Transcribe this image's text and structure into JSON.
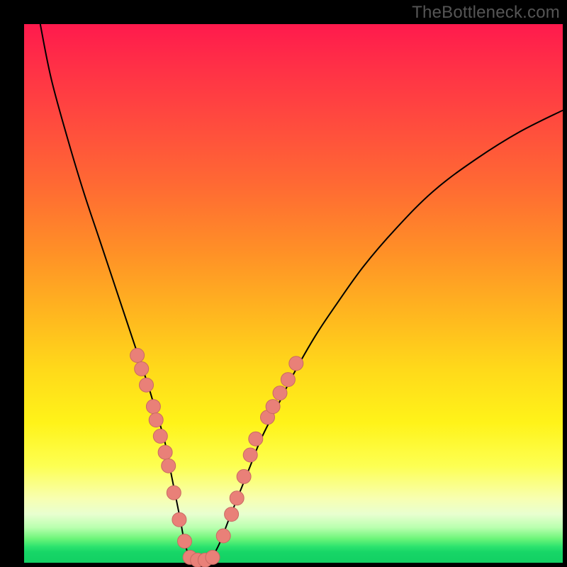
{
  "watermark": "TheBottleneck.com",
  "chart_data": {
    "type": "line",
    "title": "",
    "xlabel": "",
    "ylabel": "",
    "xlim": [
      0,
      100
    ],
    "ylim": [
      0,
      100
    ],
    "grid": false,
    "series": [
      {
        "name": "bottleneck-curve",
        "x": [
          3,
          5,
          8,
          11,
          14,
          17,
          19,
          21,
          23,
          24.5,
          26,
          27,
          28,
          29,
          30,
          31.5,
          34,
          36,
          38,
          40,
          42,
          44,
          47,
          50,
          54,
          58,
          63,
          69,
          76,
          84,
          92,
          100
        ],
        "y": [
          100,
          90,
          79,
          69,
          60,
          51,
          45,
          39,
          33,
          28,
          23,
          18,
          13,
          8,
          3,
          0,
          0,
          3,
          8,
          13,
          18,
          23,
          29,
          35,
          42,
          48,
          55,
          62,
          69,
          75,
          80,
          84
        ],
        "stroke": "#000000",
        "stroke_width": 2
      }
    ],
    "markers": [
      {
        "name": "left-cluster",
        "points": [
          {
            "x": 21.0,
            "y": 38.5
          },
          {
            "x": 21.8,
            "y": 36.0
          },
          {
            "x": 22.7,
            "y": 33.0
          },
          {
            "x": 24.0,
            "y": 29.0
          },
          {
            "x": 24.5,
            "y": 26.5
          },
          {
            "x": 25.3,
            "y": 23.5
          },
          {
            "x": 26.2,
            "y": 20.5
          },
          {
            "x": 26.8,
            "y": 18.0
          },
          {
            "x": 27.8,
            "y": 13.0
          },
          {
            "x": 28.8,
            "y": 8.0
          },
          {
            "x": 29.8,
            "y": 4.0
          }
        ]
      },
      {
        "name": "bottom-cluster",
        "points": [
          {
            "x": 30.8,
            "y": 1.0
          },
          {
            "x": 32.2,
            "y": 0.5
          },
          {
            "x": 33.6,
            "y": 0.5
          },
          {
            "x": 35.0,
            "y": 1.0
          }
        ]
      },
      {
        "name": "right-cluster",
        "points": [
          {
            "x": 37.0,
            "y": 5.0
          },
          {
            "x": 38.5,
            "y": 9.0
          },
          {
            "x": 39.5,
            "y": 12.0
          },
          {
            "x": 40.8,
            "y": 16.0
          },
          {
            "x": 42.0,
            "y": 20.0
          },
          {
            "x": 43.0,
            "y": 23.0
          },
          {
            "x": 45.2,
            "y": 27.0
          },
          {
            "x": 46.2,
            "y": 29.0
          },
          {
            "x": 47.5,
            "y": 31.5
          },
          {
            "x": 49.0,
            "y": 34.0
          },
          {
            "x": 50.5,
            "y": 37.0
          }
        ]
      }
    ],
    "marker_style": {
      "fill": "#e98078",
      "stroke": "#c96a63",
      "radius_px": 10
    }
  }
}
